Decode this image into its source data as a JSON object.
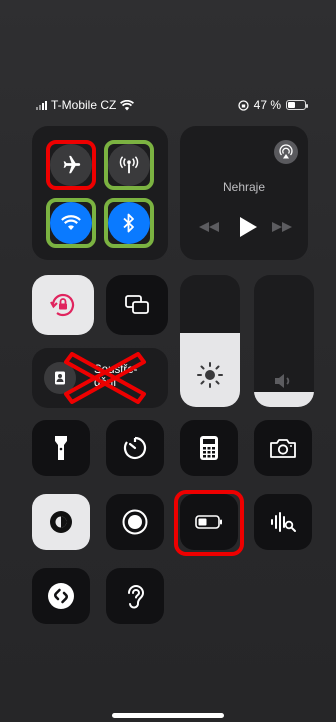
{
  "status_bar": {
    "carrier": "T-Mobile CZ",
    "battery_text": "47 %",
    "battery_level": 0.47
  },
  "media": {
    "now_playing": "Nehraje"
  },
  "focus": {
    "label": "Soustře-\ndění"
  },
  "sliders": {
    "brightness_level": 0.56,
    "volume_level": 0.11
  },
  "icons": [
    "airplane-icon",
    "cellular-icon",
    "wifi-icon",
    "bluetooth-icon",
    "airplay-icon",
    "rewind-icon",
    "play-icon",
    "forward-icon",
    "rotation-lock-icon",
    "screen-mirroring-icon",
    "sun-icon",
    "speaker-icon",
    "person-icon",
    "flashlight-icon",
    "timer-icon",
    "calculator-icon",
    "camera-icon",
    "dark-mode-icon",
    "screen-record-icon",
    "low-power-battery-icon",
    "sound-recognition-icon",
    "shazam-icon",
    "hearing-icon"
  ]
}
